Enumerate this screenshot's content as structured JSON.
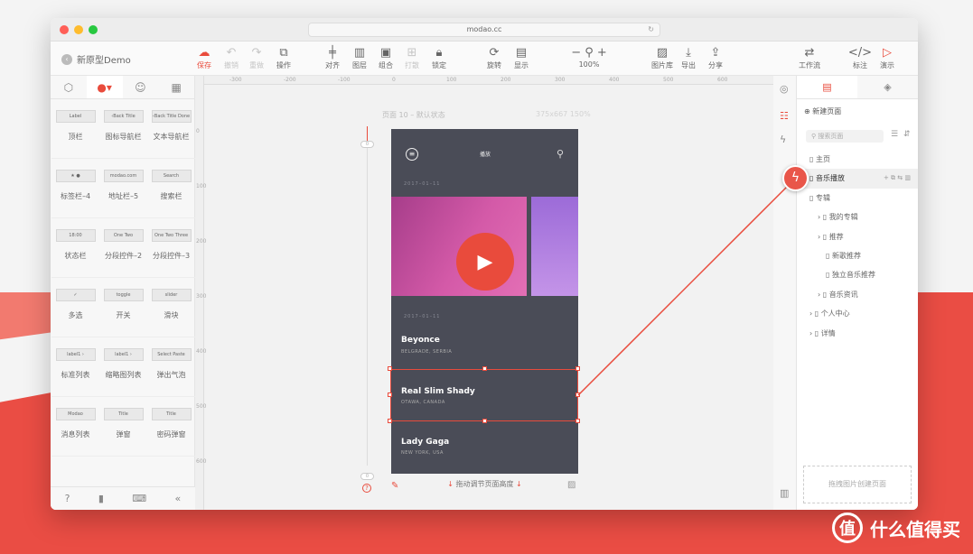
{
  "browser": {
    "url": "modao.cc",
    "dots": [
      "#ff5f57",
      "#febc2e",
      "#28c840"
    ]
  },
  "toolbar": {
    "project_name": "新原型Demo",
    "buttons": [
      {
        "id": "save",
        "label": "保存",
        "icon": "cloud-upload-icon"
      },
      {
        "id": "undo",
        "label": "撤销",
        "icon": "undo-icon"
      },
      {
        "id": "redo",
        "label": "重做",
        "icon": "redo-icon"
      },
      {
        "id": "ops",
        "label": "操作",
        "icon": "copy-icon"
      },
      {
        "id": "align",
        "label": "对齐",
        "icon": "align-icon"
      },
      {
        "id": "layer",
        "label": "图层",
        "icon": "layers-icon"
      },
      {
        "id": "group",
        "label": "组合",
        "icon": "group-icon"
      },
      {
        "id": "ungroup",
        "label": "打散",
        "icon": "ungroup-icon"
      },
      {
        "id": "lock",
        "label": "锁定",
        "icon": "lock-icon"
      },
      {
        "id": "rotate",
        "label": "旋转",
        "icon": "rotate-icon"
      },
      {
        "id": "display",
        "label": "显示",
        "icon": "display-icon"
      },
      {
        "id": "zoom",
        "label": "100%",
        "icon": "zoom-icon"
      },
      {
        "id": "gallery",
        "label": "图片库",
        "icon": "image-icon"
      },
      {
        "id": "export",
        "label": "导出",
        "icon": "download-icon"
      },
      {
        "id": "share",
        "label": "分享",
        "icon": "share-icon"
      },
      {
        "id": "flow",
        "label": "工作流",
        "icon": "flow-icon"
      },
      {
        "id": "annotate",
        "label": "标注",
        "icon": "code-icon"
      },
      {
        "id": "present",
        "label": "演示",
        "icon": "play-circle-icon"
      }
    ]
  },
  "left_panel": {
    "components": [
      {
        "label": "顶栏",
        "thumb": "Label"
      },
      {
        "label": "图标导航栏",
        "thumb": "‹Back  Title"
      },
      {
        "label": "文本导航栏",
        "thumb": "‹Back Title Done"
      },
      {
        "label": "标签栏–4",
        "thumb": "★     ●"
      },
      {
        "label": "地址栏–5",
        "thumb": "modao.com"
      },
      {
        "label": "搜索栏",
        "thumb": "Search"
      },
      {
        "label": "状态栏",
        "thumb": "18:00"
      },
      {
        "label": "分段控件–2",
        "thumb": "One Two"
      },
      {
        "label": "分段控件–3",
        "thumb": "One Two Three"
      },
      {
        "label": "多选",
        "thumb": "✓"
      },
      {
        "label": "开关",
        "thumb": "toggle"
      },
      {
        "label": "滑块",
        "thumb": "slider"
      },
      {
        "label": "标准列表",
        "thumb": "label1 ›"
      },
      {
        "label": "缩略图列表",
        "thumb": "label1 ›"
      },
      {
        "label": "弹出气泡",
        "thumb": "Select Paste"
      },
      {
        "label": "消息列表",
        "thumb": "Modao"
      },
      {
        "label": "弹窗",
        "thumb": "Title"
      },
      {
        "label": "密码弹窗",
        "thumb": "Title"
      }
    ]
  },
  "canvas": {
    "page_label": "页面 10 – 默认状态",
    "page_size": "375x667 150%",
    "ruler_h": [
      "-300",
      "-200",
      "-100",
      "0",
      "100",
      "200",
      "300",
      "400",
      "500",
      "600"
    ],
    "ruler_v": [
      "0",
      "100",
      "200",
      "300",
      "400",
      "500",
      "600"
    ],
    "slider_top": "0",
    "slider_bottom": "0",
    "footer_hint": "拖动调节页面高度",
    "phone": {
      "app_title": "播放",
      "date1": "2017–01–11",
      "date2": "2017–01–11",
      "artists": [
        {
          "name": "Beyonce",
          "loc": "BELGRADE, SERBIA"
        },
        {
          "name": "Real Slim Shady",
          "loc": "OTAWA, CANADA"
        },
        {
          "name": "Lady Gaga",
          "loc": "NEW YORK, USA"
        }
      ]
    }
  },
  "right_panel": {
    "new_page": "新建页面",
    "search_placeholder": "搜索页面",
    "pages": [
      {
        "label": "主页",
        "indent": 0
      },
      {
        "label": "音乐播放",
        "indent": 0,
        "selected": true
      },
      {
        "label": "专辑",
        "indent": 0
      },
      {
        "label": "我的专辑",
        "indent": 1,
        "folder": true
      },
      {
        "label": "推荐",
        "indent": 1,
        "folder": true
      },
      {
        "label": "新歌推荐",
        "indent": 2
      },
      {
        "label": "独立音乐推荐",
        "indent": 2
      },
      {
        "label": "音乐资讯",
        "indent": 1,
        "folder": true
      },
      {
        "label": "个人中心",
        "indent": 0,
        "folder": true
      },
      {
        "label": "详情",
        "indent": 0,
        "folder": true
      }
    ],
    "dropzone": "拖拽图片创建页面"
  },
  "watermark": "什么值得买",
  "colors": {
    "accent": "#e94b3c",
    "phone_bg": "#4a4c57"
  }
}
